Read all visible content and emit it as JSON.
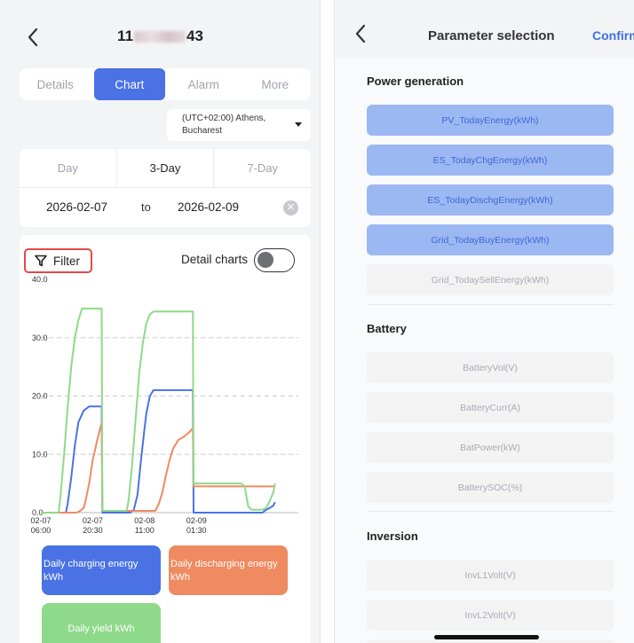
{
  "left": {
    "title_prefix": "11",
    "title_suffix": "43",
    "tabs": [
      {
        "label": "Details",
        "active": false
      },
      {
        "label": "Chart",
        "active": true
      },
      {
        "label": "Alarm",
        "active": false
      },
      {
        "label": "More",
        "active": false
      }
    ],
    "timezone": {
      "line1": "(UTC+02:00) Athens,",
      "line2": "Bucharest"
    },
    "range_tabs": [
      {
        "label": "Day",
        "active": false
      },
      {
        "label": "3-Day",
        "active": true
      },
      {
        "label": "7-Day",
        "active": false
      }
    ],
    "date_from": "2026-02-07",
    "date_to_label": "to",
    "date_end": "2026-02-09",
    "clear_symbol": "✕",
    "filter_label": "Filter",
    "detail_label": "Detail charts",
    "detail_on": false,
    "legend": {
      "charging": "Daily charging energy kWh",
      "discharging": "Daily discharging energy kWh",
      "yield": "Daily yield kWh"
    }
  },
  "colors": {
    "accent": "#4a72e5",
    "charging": "#4a72e5",
    "discharging": "#ef8a61",
    "yield": "#8fd98a",
    "filter_border": "#e04a4a",
    "selected_param_bg": "#9cb8f2",
    "selected_param_text": "#3d66d6",
    "confirm": "#3f6fe0"
  },
  "chart_data": {
    "type": "line",
    "ylim": [
      0,
      40
    ],
    "yticks": [
      "0.0",
      "10.0",
      "20.0",
      "30.0",
      "40.0"
    ],
    "ytick_values": [
      0,
      10,
      20,
      30,
      40
    ],
    "xlim": [
      0,
      72
    ],
    "xticks": [
      {
        "value": 0,
        "label": [
          "02-07",
          "06:00"
        ]
      },
      {
        "value": 14.5,
        "label": [
          "02-07",
          "20:30"
        ]
      },
      {
        "value": 29,
        "label": [
          "02-08",
          "11:00"
        ]
      },
      {
        "value": 43.5,
        "label": [
          "02-09",
          "01:30"
        ]
      }
    ],
    "series": [
      {
        "name": "Daily charging energy kWh",
        "color": "#4a72e5",
        "x": [
          0,
          7,
          7.5,
          8.5,
          9.5,
          10.5,
          12,
          13.5,
          17,
          17.2,
          25,
          26,
          27,
          28,
          29,
          29.5,
          30.5,
          31.5,
          33,
          42.5,
          42.7,
          61,
          62,
          63,
          64,
          65,
          65.5
        ],
        "y": [
          0,
          0,
          1.5,
          6,
          11.5,
          15.5,
          17.5,
          18.2,
          18.2,
          0,
          0,
          0.5,
          3,
          9,
          14.5,
          17,
          20,
          21,
          21,
          21,
          0,
          0,
          0,
          0.5,
          0.8,
          1.2,
          1.8
        ]
      },
      {
        "name": "Daily discharging energy kWh",
        "color": "#ef8a61",
        "x": [
          0,
          10,
          11,
          12,
          12.5,
          13.5,
          14.5,
          16,
          17,
          17.2,
          32,
          33,
          34,
          35,
          36,
          37,
          38.5,
          40,
          41.5,
          42.5,
          42.7,
          65.5
        ],
        "y": [
          0,
          0,
          0.3,
          0.8,
          2,
          5,
          9,
          13,
          15.5,
          0.3,
          0.3,
          1.5,
          3.5,
          6.5,
          9,
          11,
          12.5,
          13,
          13.8,
          14.5,
          4.5,
          4.5
        ]
      },
      {
        "name": "Daily yield kWh",
        "color": "#8fd98a",
        "x": [
          0,
          5,
          5.5,
          6.5,
          7.5,
          8.5,
          9.5,
          10.5,
          11.5,
          12.5,
          17,
          17.2,
          24,
          24.5,
          25.5,
          26.5,
          27.5,
          28.5,
          29.5,
          30.5,
          31.5,
          32.5,
          33,
          35,
          36.5,
          42.5,
          42.7,
          56,
          57,
          58,
          59,
          60,
          61,
          62,
          63,
          64,
          65,
          65.5
        ],
        "y": [
          0,
          0,
          3,
          10,
          18,
          25,
          30,
          33,
          35,
          35,
          35,
          0.3,
          0.3,
          2,
          8,
          16,
          24,
          29,
          32.5,
          34,
          34.5,
          34.5,
          34.5,
          34.5,
          34.5,
          34.5,
          5,
          5,
          4.5,
          1,
          0.5,
          0.5,
          0.5,
          0.5,
          0.8,
          2,
          3.5,
          5
        ]
      }
    ]
  },
  "right": {
    "title": "Parameter selection",
    "confirm": "Confirm",
    "sections": [
      {
        "label": "Power generation",
        "params": [
          {
            "label": "PV_TodayEnergy(kWh)",
            "selected": true
          },
          {
            "label": "ES_TodayChgEnergy(kWh)",
            "selected": true
          },
          {
            "label": "ES_TodayDischgEnergy(kWh)",
            "selected": true
          },
          {
            "label": "Grid_TodayBuyEnergy(kWh)",
            "selected": true
          },
          {
            "label": "Grid_TodaySellEnergy(kWh)",
            "selected": false
          }
        ]
      },
      {
        "label": "Battery",
        "params": [
          {
            "label": "BatteryVol(V)",
            "selected": false
          },
          {
            "label": "BatteryCurr(A)",
            "selected": false
          },
          {
            "label": "BatPower(kW)",
            "selected": false
          },
          {
            "label": "BatterySOC(%)",
            "selected": false
          }
        ]
      },
      {
        "label": "Inversion",
        "params": [
          {
            "label": "InvL1Volt(V)",
            "selected": false
          },
          {
            "label": "InvL2Volt(V)",
            "selected": false
          }
        ]
      }
    ]
  }
}
